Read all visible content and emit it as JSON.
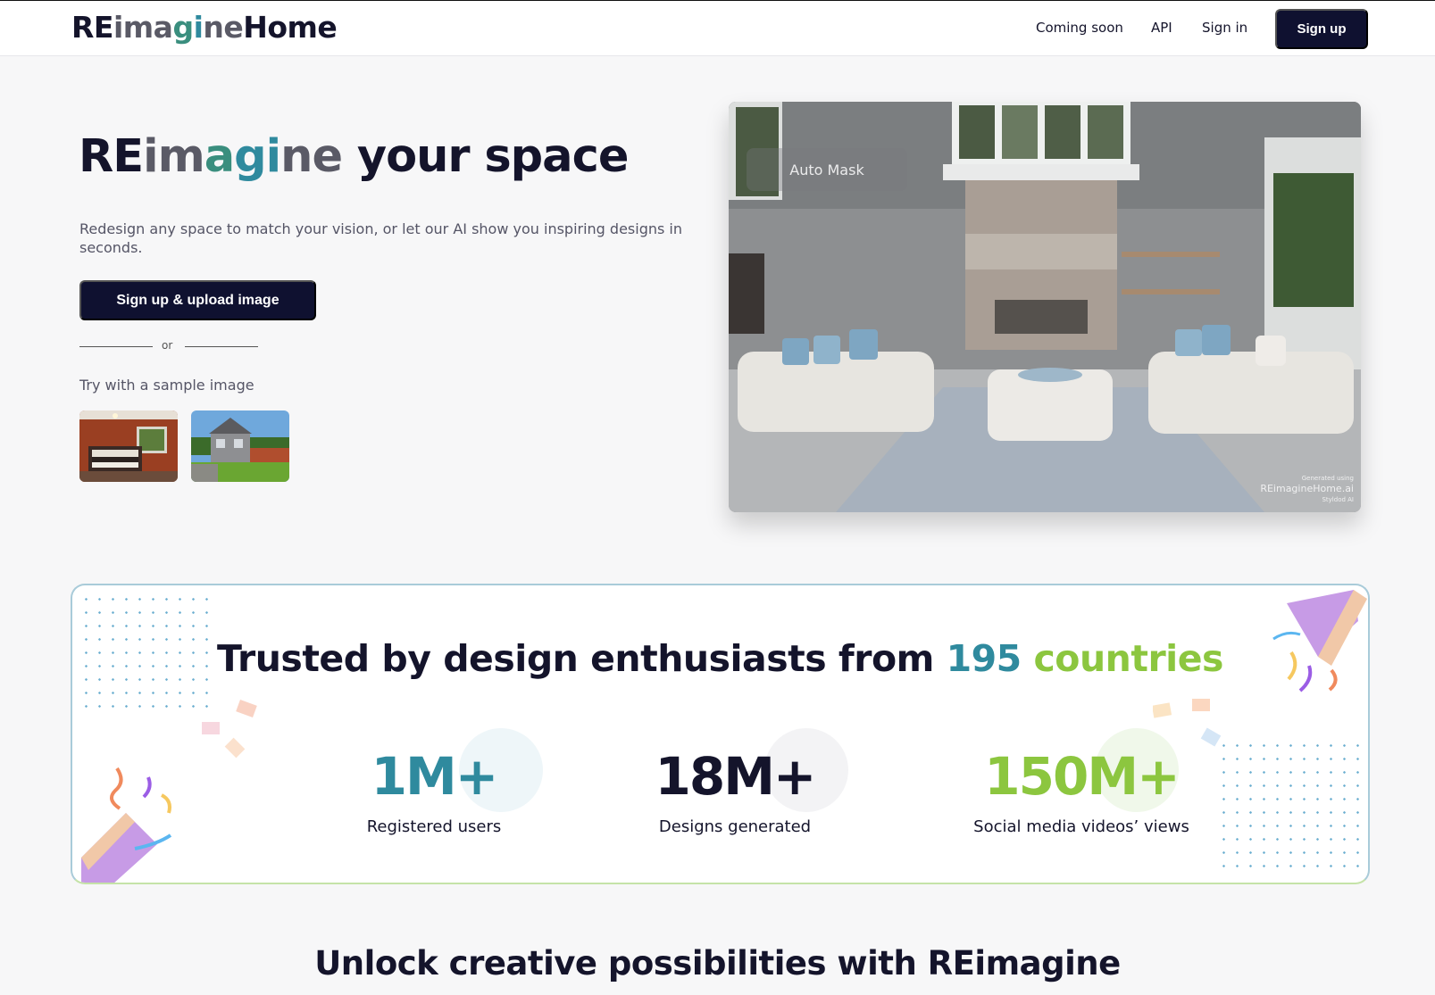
{
  "header": {
    "logo": {
      "re": "RE",
      "i1": "im",
      "a": "a",
      "g": "g",
      "i2": "i",
      "ne": "ne",
      "home": "Home"
    },
    "nav": {
      "coming_soon": "Coming soon",
      "api": "API",
      "sign_in": "Sign in"
    },
    "sign_up": "Sign up"
  },
  "hero": {
    "title": {
      "re": "RE",
      "im": "im",
      "a": "a",
      "g": "g",
      "i": "i",
      "ne": "ne",
      "rest": " your space"
    },
    "subtitle": "Redesign any space to match your vision, or let our AI show you inspiring designs in seconds.",
    "upload_button": "Sign up & upload image",
    "or": "or",
    "sample_label": "Try with a sample image",
    "image": {
      "mask_label": "Auto Mask",
      "watermark_small": "Generated using",
      "watermark_main": "REimagineHome.ai",
      "watermark_sub": "Styldod AI"
    }
  },
  "trusted": {
    "title_prefix": "Trusted by design enthusiasts from ",
    "title_number": "195",
    "title_suffix": " countries",
    "stats": [
      {
        "value": "1M+",
        "label": "Registered users"
      },
      {
        "value": "18M+",
        "label": "Designs generated"
      },
      {
        "value": "150M+",
        "label": "Social media videos’ views"
      }
    ]
  },
  "section_heading": "Unlock creative possibilities with REimagine",
  "colors": {
    "brand_dark": "#0f1130",
    "teal": "#2f8a9e",
    "green": "#8cc63f"
  }
}
